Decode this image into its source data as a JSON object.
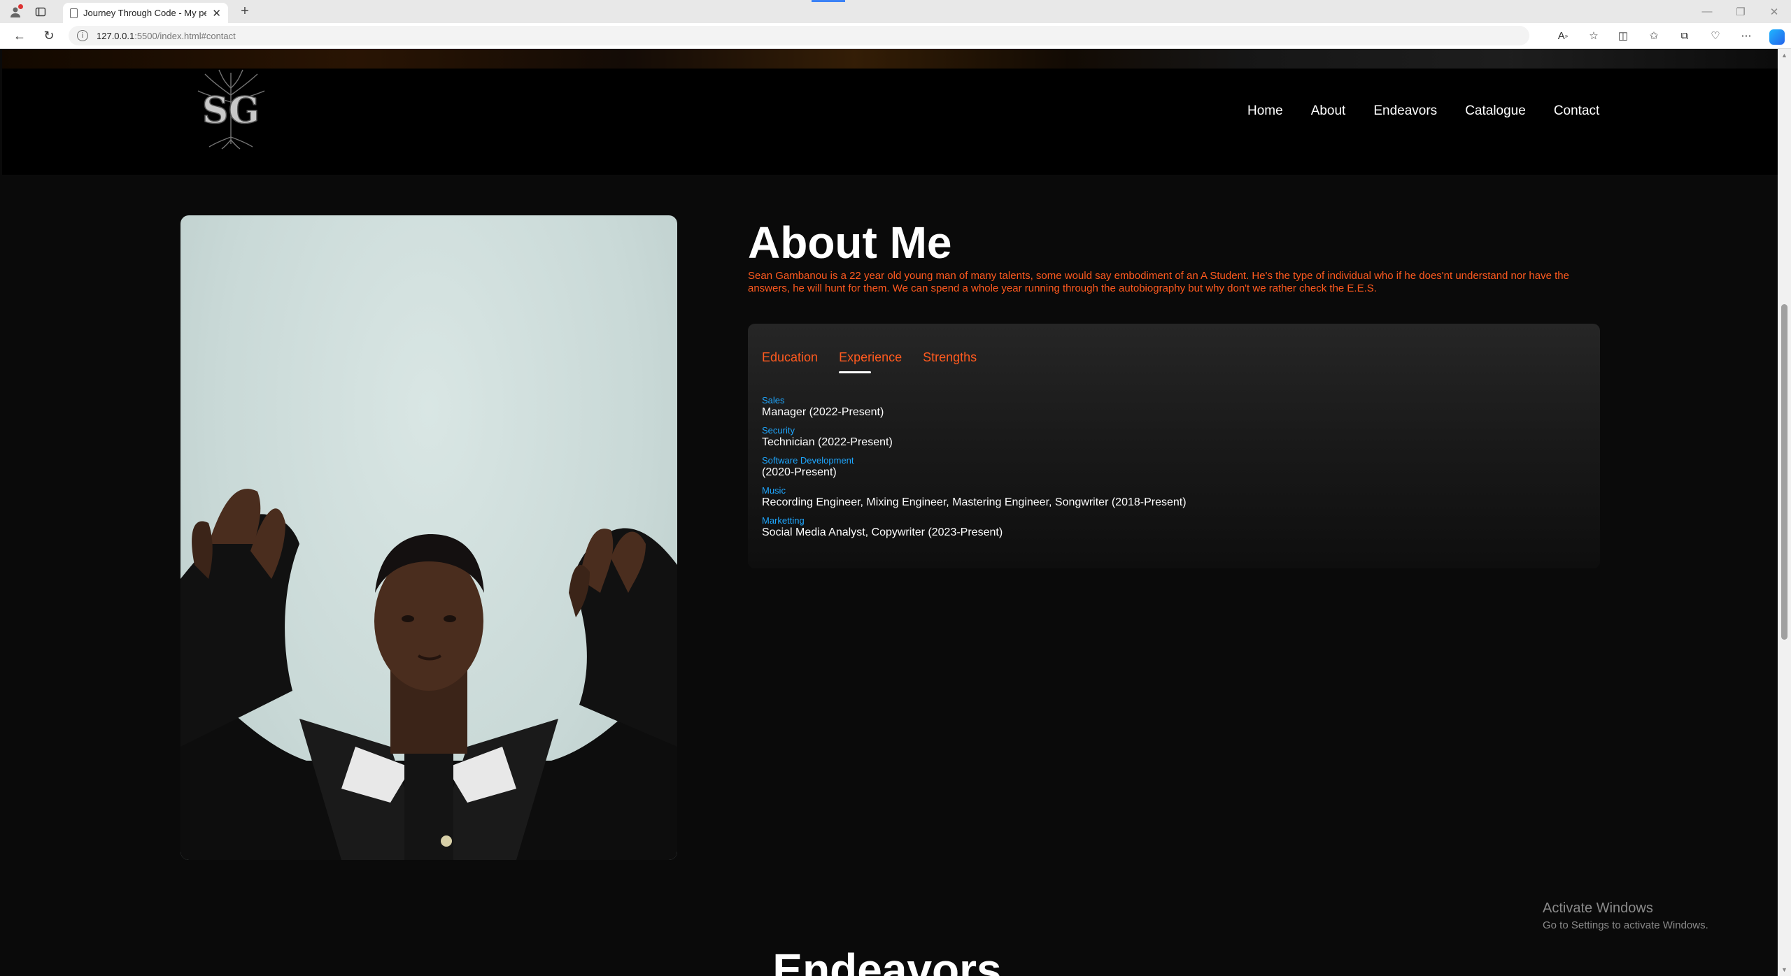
{
  "browser": {
    "tab_title": "Journey Through Code - My per",
    "url_host": "127.0.0.1",
    "url_rest": ":5500/index.html#contact"
  },
  "site": {
    "logo_text": "SG",
    "nav": [
      "Home",
      "About",
      "Endeavors",
      "Catalogue",
      "Contact"
    ]
  },
  "about": {
    "title": "About Me",
    "description": "Sean Gambanou is a 22 year old young man of many talents, some would say embodiment of an A Student. He's the type of individual who if he does'nt understand nor have the answers, he will hunt for them. We can spend a whole year running through the autobiography but why don't we rather check the E.E.S.",
    "tabs": [
      "Education",
      "Experience",
      "Strengths"
    ],
    "active_tab": "Experience",
    "experience": [
      {
        "category": "Sales",
        "detail": "Manager (2022-Present)"
      },
      {
        "category": "Security",
        "detail": "Technician (2022-Present)"
      },
      {
        "category": "Software Development",
        "detail": "(2020-Present)"
      },
      {
        "category": "Music",
        "detail": "Recording Engineer, Mixing Engineer, Mastering Engineer, Songwriter (2018-Present)"
      },
      {
        "category": "Marketting",
        "detail": "Social Media Analyst, Copywriter (2023-Present)"
      }
    ]
  },
  "endeavors": {
    "title": "Endeavors"
  },
  "watermark": {
    "title": "Activate Windows",
    "subtitle": "Go to Settings to activate Windows."
  },
  "colors": {
    "accent_orange": "#ff5a1f",
    "accent_blue": "#1ea7ff",
    "background": "#0a0a0a"
  }
}
